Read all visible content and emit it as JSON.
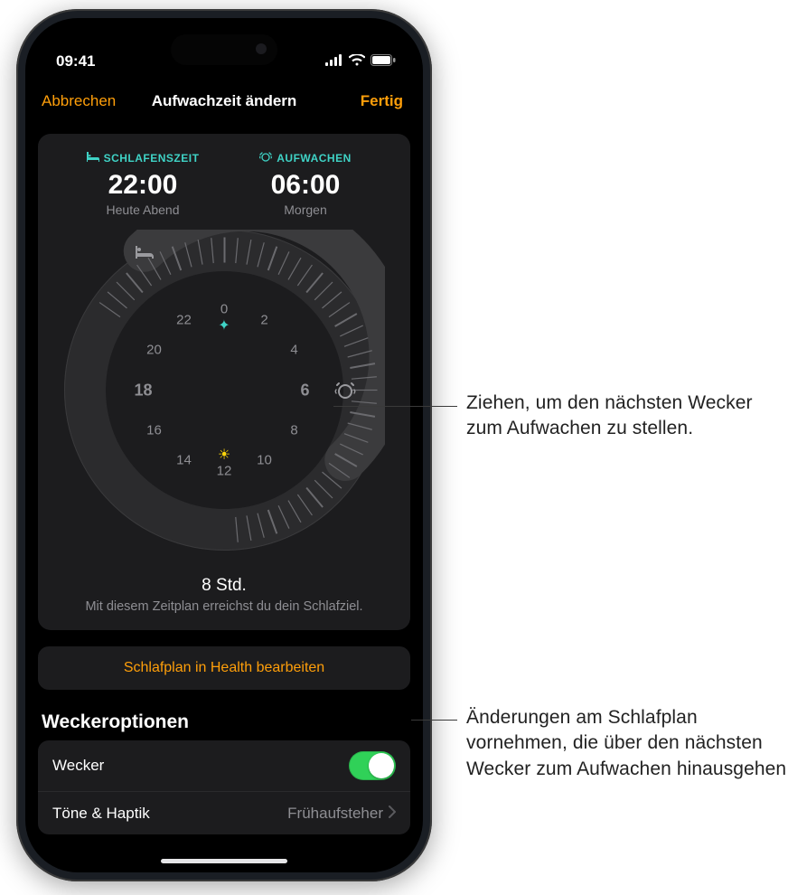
{
  "status": {
    "time": "09:41"
  },
  "nav": {
    "cancel": "Abbrechen",
    "title": "Aufwachzeit ändern",
    "done": "Fertig"
  },
  "sleep": {
    "bed_label": "SCHLAFENSZEIT",
    "bed_time": "22:00",
    "bed_sub": "Heute Abend",
    "wake_label": "AUFWACHEN",
    "wake_time": "06:00",
    "wake_sub": "Morgen"
  },
  "dial": {
    "hours": [
      "0",
      "2",
      "4",
      "6",
      "8",
      "10",
      "12",
      "14",
      "16",
      "18",
      "20",
      "22"
    ]
  },
  "duration": {
    "main": "8 Std.",
    "sub": "Mit diesem Zeitplan erreichst du dein Schlafziel."
  },
  "edit_button": "Schlafplan in Health bearbeiten",
  "options_header": "Weckeroptionen",
  "options": {
    "alarm_label": "Wecker",
    "sounds_label": "Töne & Haptik",
    "sounds_value": "Frühaufsteher"
  },
  "callouts": {
    "c1": "Ziehen, um den nächsten Wecker zum Aufwachen zu stellen.",
    "c2": "Änderungen am Schlafplan vornehmen, die über den nächsten Wecker zum Aufwachen hinausgehen"
  }
}
